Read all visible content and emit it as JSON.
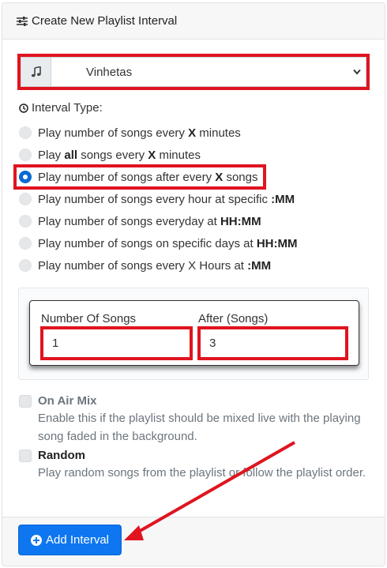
{
  "header": {
    "title": "Create New Playlist Interval",
    "icon": "sliders-icon"
  },
  "playlist_select": {
    "value": "Vinhetas",
    "icon": "music-icon"
  },
  "interval_type": {
    "label": "Interval Type:",
    "options": [
      {
        "parts": [
          "Play number of songs every ",
          "X",
          " minutes"
        ],
        "checked": false
      },
      {
        "parts": [
          "Play ",
          "all",
          " songs every ",
          "X",
          " minutes"
        ],
        "checked": false
      },
      {
        "parts": [
          "Play number of songs after every ",
          "X",
          " songs"
        ],
        "checked": true
      },
      {
        "parts": [
          "Play number of songs every hour at specific ",
          ":MM"
        ],
        "checked": false
      },
      {
        "parts": [
          "Play number of songs everyday at ",
          "HH:MM"
        ],
        "checked": false
      },
      {
        "parts": [
          "Play number of songs on specific days at ",
          "HH:MM"
        ],
        "checked": false
      },
      {
        "parts": [
          "Play number of songs every X Hours at ",
          ":MM"
        ],
        "checked": false
      }
    ]
  },
  "fields": {
    "number_of_songs": {
      "label": "Number Of Songs",
      "value": "1"
    },
    "after_songs": {
      "label": "After (Songs)",
      "value": "3"
    }
  },
  "on_air_mix": {
    "label": "On Air Mix",
    "help": "Enable this if the playlist should be mixed live with the playing song faded in the background."
  },
  "random": {
    "label": "Random",
    "help": "Play random songs from the playlist or follow the playlist order."
  },
  "footer": {
    "add_button_label": "Add Interval"
  },
  "colors": {
    "accent": "#0d76f0",
    "highlight": "#e0141f"
  }
}
